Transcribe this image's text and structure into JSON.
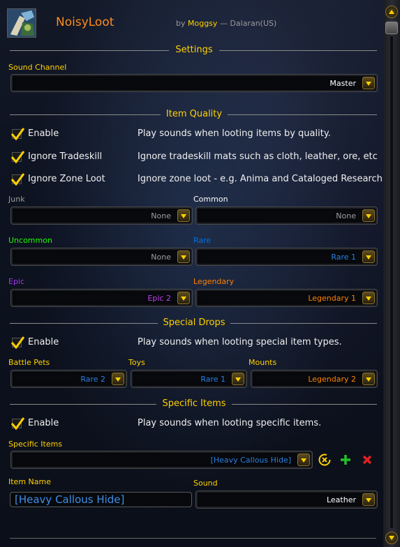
{
  "header": {
    "title": "NoisyLoot",
    "by": "by",
    "author": "Moggsy",
    "realm": "— Dalaran(US)"
  },
  "settings": {
    "section_title": "Settings",
    "sound_channel_label": "Sound Channel",
    "sound_channel_value": "Master"
  },
  "item_quality": {
    "section_title": "Item Quality",
    "enable_label": "Enable",
    "enable_desc": "Play sounds when looting items by quality.",
    "ignore_tradeskill_label": "Ignore Tradeskill",
    "ignore_tradeskill_desc": "Ignore tradeskill mats such as cloth, leather, ore, etc",
    "ignore_zone_label": "Ignore Zone Loot",
    "ignore_zone_desc": "Ignore zone loot - e.g. Anima and Cataloged Research",
    "junk_label": "Junk",
    "junk_value": "None",
    "common_label": "Common",
    "common_value": "None",
    "uncommon_label": "Uncommon",
    "uncommon_value": "None",
    "rare_label": "Rare",
    "rare_value": "Rare 1",
    "epic_label": "Epic",
    "epic_value": "Epic 2",
    "legendary_label": "Legendary",
    "legendary_value": "Legendary 1"
  },
  "special_drops": {
    "section_title": "Special Drops",
    "enable_label": "Enable",
    "enable_desc": "Play sounds when looting special item types.",
    "battle_pets_label": "Battle Pets",
    "battle_pets_value": "Rare 2",
    "toys_label": "Toys",
    "toys_value": "Rare 1",
    "mounts_label": "Mounts",
    "mounts_value": "Legendary 2"
  },
  "specific_items": {
    "section_title": "Specific Items",
    "enable_label": "Enable",
    "enable_desc": "Play sounds when looting specific items.",
    "list_label": "Specific Items",
    "list_value": "[Heavy Callous Hide]",
    "item_name_label": "Item Name",
    "item_name_value": "[Heavy Callous Hide]",
    "sound_label": "Sound",
    "sound_value": "Leather"
  },
  "colors": {
    "gold": "#ffd100",
    "title_orange": "#ff8c1a",
    "uncommon": "#1eff00",
    "rare": "#0070dd",
    "epic": "#a335ee",
    "legendary": "#ff8000",
    "junk": "#9d9d9d",
    "common": "#ffffff"
  },
  "icons": {
    "addon": "addon-portrait-icon",
    "checkmark": "checkmark-icon",
    "dropdown_arrow": "chevron-down-icon",
    "clear": "clear-icon",
    "add": "plus-icon",
    "remove": "close-icon"
  }
}
